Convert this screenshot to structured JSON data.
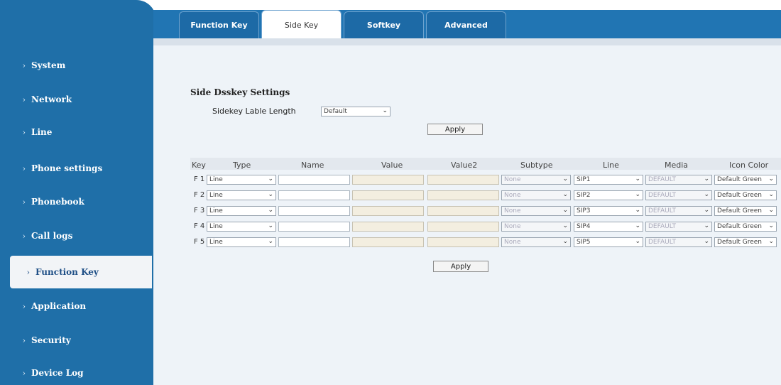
{
  "sidebar": {
    "items": [
      {
        "label": "System"
      },
      {
        "label": "Network"
      },
      {
        "label": "Line"
      },
      {
        "label": "Phone settings"
      },
      {
        "label": "Phonebook"
      },
      {
        "label": "Call logs"
      },
      {
        "label": "Function Key",
        "active": true
      },
      {
        "label": "Application"
      },
      {
        "label": "Security"
      },
      {
        "label": "Device Log"
      }
    ],
    "arrow": "›",
    "active_arrow": "›"
  },
  "tabs": [
    {
      "label": "Function Key"
    },
    {
      "label": "Side Key",
      "active": true
    },
    {
      "label": "Softkey"
    },
    {
      "label": "Advanced"
    }
  ],
  "section": {
    "title": "Side Dsskey Settings",
    "length_label": "Sidekey Lable Length",
    "length_value": "Default",
    "apply_label": "Apply"
  },
  "table": {
    "headers": [
      "Key",
      "Type",
      "Name",
      "Value",
      "Value2",
      "Subtype",
      "Line",
      "Media",
      "Icon Color"
    ],
    "rows": [
      {
        "key": "F 1",
        "type": "Line",
        "name": "",
        "value": "",
        "value2": "",
        "subtype": "None",
        "line": "SIP1",
        "media": "DEFAULT",
        "icon_color": "Default Green"
      },
      {
        "key": "F 2",
        "type": "Line",
        "name": "",
        "value": "",
        "value2": "",
        "subtype": "None",
        "line": "SIP2",
        "media": "DEFAULT",
        "icon_color": "Default Green"
      },
      {
        "key": "F 3",
        "type": "Line",
        "name": "",
        "value": "",
        "value2": "",
        "subtype": "None",
        "line": "SIP3",
        "media": "DEFAULT",
        "icon_color": "Default Green"
      },
      {
        "key": "F 4",
        "type": "Line",
        "name": "",
        "value": "",
        "value2": "",
        "subtype": "None",
        "line": "SIP4",
        "media": "DEFAULT",
        "icon_color": "Default Green"
      },
      {
        "key": "F 5",
        "type": "Line",
        "name": "",
        "value": "",
        "value2": "",
        "subtype": "None",
        "line": "SIP5",
        "media": "DEFAULT",
        "icon_color": "Default Green"
      }
    ],
    "apply_label": "Apply"
  },
  "chev": "⌄",
  "colors": {
    "sidebar": "#1f6fa8",
    "tabbar": "#2175b3",
    "content_bg": "#eef3f8"
  }
}
